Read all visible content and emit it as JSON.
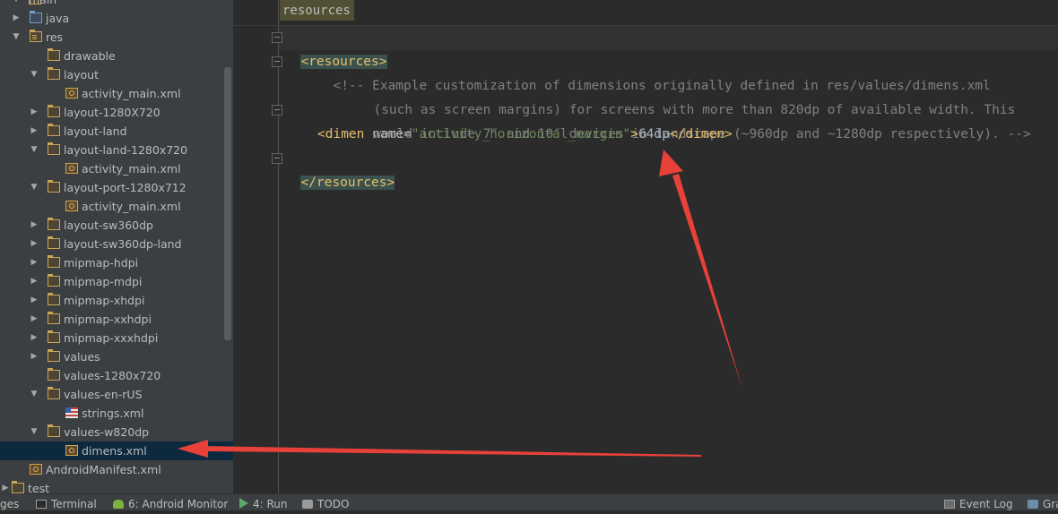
{
  "editor": {
    "breadcrumb": "resources",
    "lines": {
      "l1_open": "<resources>",
      "l2_comment": "<!-- Example customization of dimensions originally defined in res/values/dimens.xml",
      "l3_comment": "(such as screen margins) for screens with more than 820dp of available width. This",
      "l4_comment": "would include 7″ and 10″ devices in landscape (~960dp and ~1280dp respectively). -->",
      "l5_tag_open": "<dimen",
      "l5_attr": " name=",
      "l5_str": "\"activity_horizontal_margin\"",
      "l5_gt": ">",
      "l5_val": "64dp",
      "l5_tag_close": "</dimen>",
      "l6_close": "</resources>"
    }
  },
  "tree": [
    {
      "label": "main"
    },
    {
      "label": "java"
    },
    {
      "label": "res"
    },
    {
      "label": "drawable"
    },
    {
      "label": "layout"
    },
    {
      "label": "activity_main.xml"
    },
    {
      "label": "layout-1280X720"
    },
    {
      "label": "layout-land"
    },
    {
      "label": "layout-land-1280x720"
    },
    {
      "label": "activity_main.xml"
    },
    {
      "label": "layout-port-1280x712"
    },
    {
      "label": "activity_main.xml"
    },
    {
      "label": "layout-sw360dp"
    },
    {
      "label": "layout-sw360dp-land"
    },
    {
      "label": "mipmap-hdpi"
    },
    {
      "label": "mipmap-mdpi"
    },
    {
      "label": "mipmap-xhdpi"
    },
    {
      "label": "mipmap-xxhdpi"
    },
    {
      "label": "mipmap-xxxhdpi"
    },
    {
      "label": "values"
    },
    {
      "label": "values-1280x720"
    },
    {
      "label": "values-en-rUS"
    },
    {
      "label": "strings.xml"
    },
    {
      "label": "values-w820dp"
    },
    {
      "label": "dimens.xml"
    },
    {
      "label": "AndroidManifest.xml"
    },
    {
      "label": "test"
    }
  ],
  "bottom_bar": {
    "messages_partial": "ges",
    "terminal": "Terminal",
    "android_monitor": "6: Android Monitor",
    "run": "4: Run",
    "todo": "TODO",
    "event_log": "Event Log",
    "gradle_partial": "Gra"
  },
  "colors": {
    "annotation_arrow": "#e8413a",
    "selection": "#0d293e",
    "tag": "#e8bf6a",
    "string": "#6a8759",
    "comment": "#808080"
  }
}
